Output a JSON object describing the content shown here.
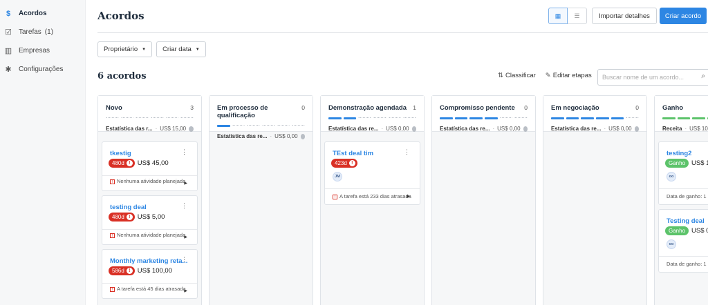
{
  "sidebar": {
    "items": [
      {
        "label": "Acordos",
        "icon": "dollar-icon",
        "glyph": "$",
        "active": true,
        "count": ""
      },
      {
        "label": "Tarefas",
        "icon": "calendar-check-icon",
        "glyph": "☑",
        "active": false,
        "count": "(1)"
      },
      {
        "label": "Empresas",
        "icon": "building-icon",
        "glyph": "▥",
        "active": false,
        "count": ""
      },
      {
        "label": "Configurações",
        "icon": "gear-icon",
        "glyph": "✱",
        "active": false,
        "count": ""
      }
    ]
  },
  "header": {
    "title": "Acordos",
    "import_label": "Importar detalhes",
    "create_label": "Criar acordo"
  },
  "filters": {
    "owner_label": "Proprietário",
    "date_label": "Criar data"
  },
  "board_summary": {
    "count_title": "6 acordos",
    "sort_label": "Classificar",
    "edit_stages_label": "Editar etapas",
    "search_placeholder": "Buscar nome de um acordo..."
  },
  "colors": {
    "accent": "#2d86e3",
    "overdue": "#d93025",
    "won": "#5cc36a"
  },
  "columns": [
    {
      "title": "Novo",
      "count": "3",
      "segments": 6,
      "filled": 0,
      "fill_color": "blue",
      "stat_label": "Estatística das r...",
      "stat_value": "US$ 15,00",
      "cards": [
        {
          "name": "tkestig",
          "days": "480d",
          "amount": "US$ 45,00",
          "footer": "Nenhuma atividade planejada"
        },
        {
          "name": "testing deal",
          "days": "480d",
          "amount": "US$ 5,00",
          "footer": "Nenhuma atividade planejada"
        },
        {
          "name": "Monthly marketing reta...",
          "days": "586d",
          "amount": "US$ 100,00",
          "footer": "A tarefa está 45 dias atrasada"
        }
      ]
    },
    {
      "title": "Em processo de qualificação",
      "count": "0",
      "segments": 6,
      "filled": 1,
      "fill_color": "blue",
      "stat_label": "Estatística das re...",
      "stat_value": "US$ 0,00",
      "cards": []
    },
    {
      "title": "Demonstração agendada",
      "count": "1",
      "segments": 6,
      "filled": 2,
      "fill_color": "blue",
      "stat_label": "Estatística das re...",
      "stat_value": "US$ 0,00",
      "cards": [
        {
          "name": "TEst deal tim",
          "days": "423d",
          "amount": "",
          "avatar": "JM",
          "footer": "A tarefa está 233 dias atrasada"
        }
      ]
    },
    {
      "title": "Compromisso pendente",
      "count": "0",
      "segments": 6,
      "filled": 4,
      "fill_color": "blue",
      "stat_label": "Estatística das re...",
      "stat_value": "US$ 0,00",
      "cards": []
    },
    {
      "title": "Em negociação",
      "count": "0",
      "segments": 6,
      "filled": 5,
      "fill_color": "blue",
      "stat_label": "Estatística das re...",
      "stat_value": "US$ 0,00",
      "cards": []
    },
    {
      "title": "Ganho",
      "count": "",
      "segments": 6,
      "filled": 6,
      "fill_color": "green",
      "stat_label": "Receita",
      "stat_value": "US$ 10",
      "cards": [
        {
          "name": "testing2",
          "won": "Ganho",
          "amount": "US$ 1",
          "avatar": "oo",
          "footer": "Data de ganho: 1"
        },
        {
          "name": "Testing deal",
          "won": "Ganho",
          "amount": "US$ 0",
          "avatar": "oo",
          "footer": "Data de ganho: 1"
        }
      ]
    }
  ]
}
